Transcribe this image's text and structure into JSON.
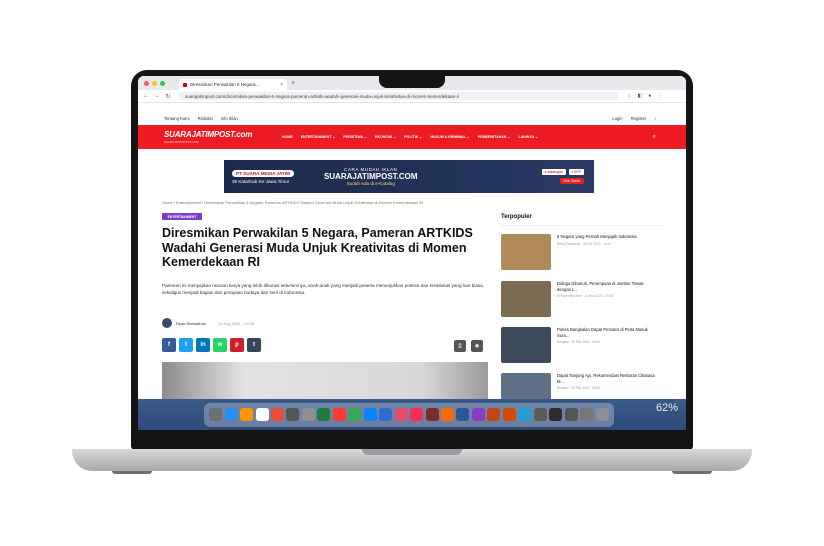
{
  "browser": {
    "tab_title": "Diresmikan Perwakilan 5 Negara...",
    "url": "suarajatimpost.com/diresmikan-perwakilan-5-negara-pameran-artkids-wadahi-generasi-muda-unjuk-kreativitas-di-momen-kemerdekaan-ri",
    "back": "←",
    "forward": "→",
    "reload": "↻",
    "new_tab": "+",
    "close": "×"
  },
  "topbar": {
    "links": [
      "Tentang Kami",
      "Redaksi",
      "Info Iklan"
    ],
    "login": "Login",
    "register": "Register",
    "theme_icon": "moon-icon"
  },
  "nav": {
    "logo": "SUARAJATIMPOST.com",
    "logo_tag": "SUARAJATIMPOST.COM",
    "items": [
      "HOME",
      "ENTERTAINMENT ⌄",
      "PERISTIWA ⌄",
      "EKONOMI ⌄",
      "POLITIK ⌄",
      "HUKUM & KRIMINAL ⌄",
      "PEMERINTAHAN ⌄",
      "LAINNYA ⌄"
    ],
    "search_icon": "search-icon"
  },
  "banner": {
    "company": "PT SUARA MEDIA JATIM",
    "coverage": "38 Kota/Kab Se-Jawa Timur",
    "headline_small": "CARA MUDAH IKLAN",
    "headline_big": "SUARAJATIMPOST.COM",
    "headline_sub": "Sudah Ada di e-Katalog",
    "partner1": "e-katalogue",
    "partner2": "LKPP",
    "cta": "Klik Disini"
  },
  "breadcrumb": "Home  /  Entertainment  /  Diresmikan Perwakilan 5 Negara, Pameran ARTKIDS Wadahi Generasi Muda Unjuk Kreativitas di Momen Kemerdekaan RI",
  "article": {
    "category": "ENTERTAINMENT",
    "title": "Diresmikan Perwakilan 5 Negara, Pameran ARTKIDS Wadahi Generasi Muda Unjuk Kreativitas di Momen Kemerdekaan RI",
    "excerpt": "Pameran ini menyajikan ratusan karya yang lebih dikurasi sebelumnya, anak-anak yang menjadi peserta menunjukkan potensi dan kreativitas yang luar biasa, sekaligus menjadi bagian dari perayaan budaya dan seni di Indonesia.",
    "author": "Ryan Ramadhan",
    "date": "13 Aug 2024 - 19:45",
    "share": [
      {
        "label": "f",
        "color": "#3b5998",
        "name": "facebook-icon"
      },
      {
        "label": "t",
        "color": "#1da1f2",
        "name": "twitter-icon"
      },
      {
        "label": "in",
        "color": "#0077b5",
        "name": "linkedin-icon"
      },
      {
        "label": "w",
        "color": "#25d366",
        "name": "whatsapp-icon"
      },
      {
        "label": "p",
        "color": "#cb2027",
        "name": "pinterest-icon"
      },
      {
        "label": "t",
        "color": "#35465c",
        "name": "tumblr-icon"
      }
    ]
  },
  "sidebar": {
    "title": "Terpopuler",
    "items": [
      {
        "title": "6 Negara yang Pernah Menjajah Indonesia",
        "meta": "Retno Setyowati  ·  06 Oct 2023 - 14:00",
        "thumb": "#b08a58"
      },
      {
        "title": "Diduga Dibunuh, Perempuan di Jember Tewas dengan L...",
        "meta": "M Rochmat Ulum  ·  13 Nov 2023 - 09:00",
        "thumb": "#7a6b52"
      },
      {
        "title": "Polres Bangkalan Dapat Pemotor di Pinta Masuk Sura...",
        "meta": "Redaksi  ·  09 Feb 2024 - 08:00",
        "thumb": "#3e4b5a"
      },
      {
        "title": "Dapat Tanjung Api, Rekomendasi Restoran Cikarasa M...",
        "meta": "Redaksi  ·  09 Feb 2024 - 08:00",
        "thumb": "#5e6f86"
      }
    ]
  },
  "dock": {
    "battery": "62%",
    "apps": [
      "#6d6d72",
      "#2b8cf3",
      "#ff9500",
      "#ffffff",
      "#e74c3c",
      "#555555",
      "#8e8e93",
      "#1f7a3c",
      "#ff3b30",
      "#3aa757",
      "#0a84ff",
      "#2f6bd1",
      "#e24d6b",
      "#ff2d55",
      "#7b2c2c",
      "#ff6a00",
      "#2b5797",
      "#8c3bc4",
      "#c4441a",
      "#d04a02",
      "#1f9ed8",
      "#5b5b5b",
      "#2d2d2d",
      "#555555",
      "#777777",
      "#8e8e93"
    ]
  },
  "colors": {
    "brand_red": "#ed1c24",
    "category_purple": "#7a3fcf"
  }
}
